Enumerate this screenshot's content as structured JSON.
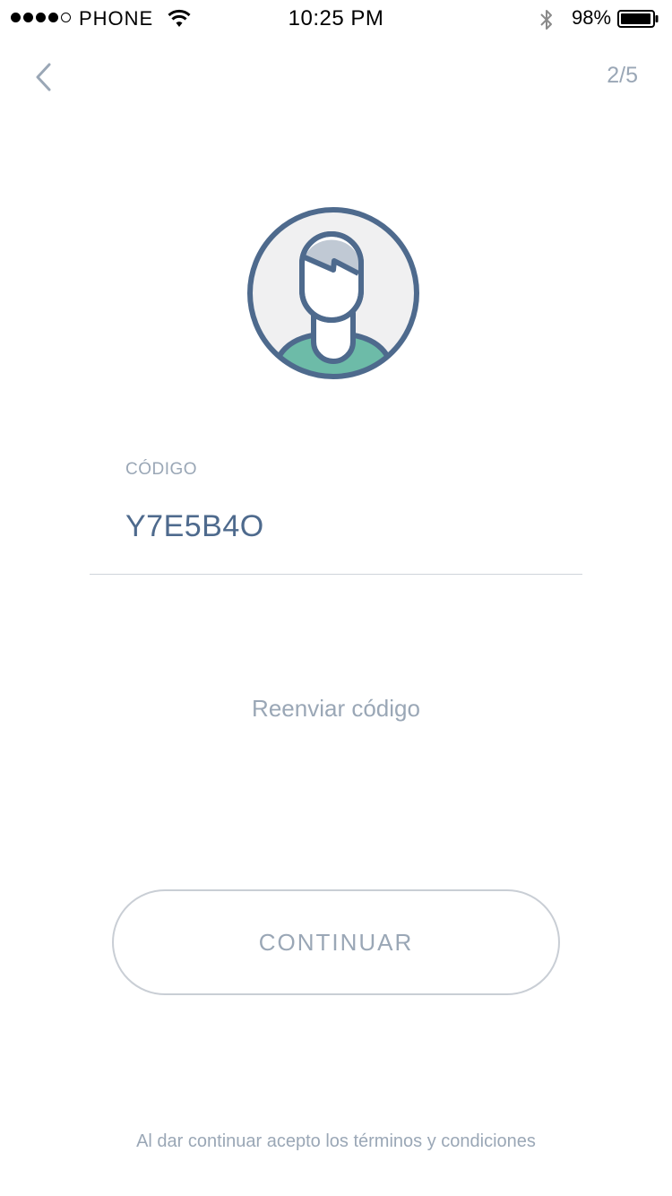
{
  "status_bar": {
    "carrier": "PHONE",
    "time": "10:25 PM",
    "battery_percent": "98%",
    "signal_bars_filled": 4,
    "signal_bars_total": 5
  },
  "nav": {
    "back_icon": "chevron-left-icon",
    "step": "2/5"
  },
  "avatar": {
    "icon": "user-avatar-icon"
  },
  "code_field": {
    "label": "CÓDIGO",
    "value": "Y7E5B4O"
  },
  "resend": {
    "label": "Reenviar código"
  },
  "continue_button": {
    "label": "CONTINUAR"
  },
  "terms": {
    "text": "Al dar continuar acepto los términos y condiciones"
  },
  "colors": {
    "primary": "#4e6a8d",
    "muted": "#9aa7b6",
    "avatar_bg": "#f0f0f1",
    "avatar_hair": "#c0c9d4",
    "avatar_shirt": "#6dbba8",
    "border": "#c9ced5"
  }
}
